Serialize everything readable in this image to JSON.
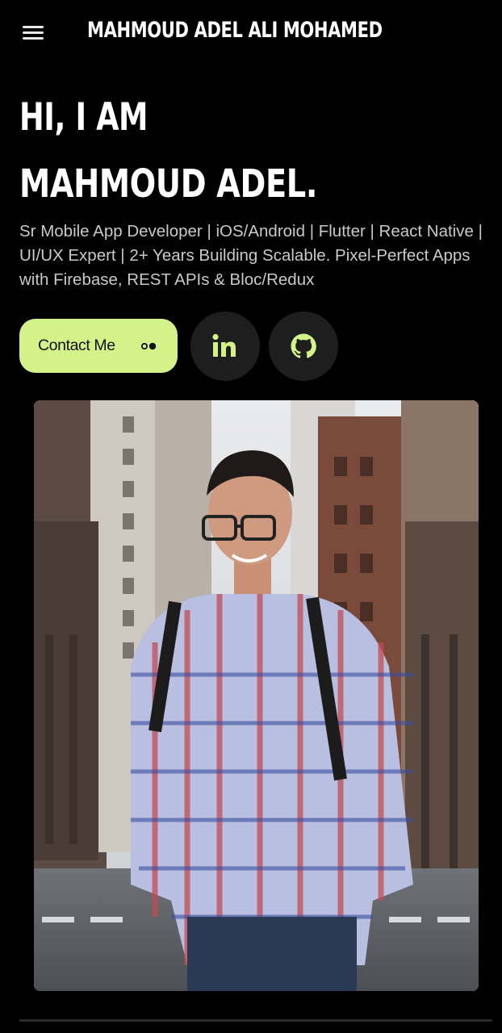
{
  "header": {
    "menu_icon": "hamburger-menu-icon",
    "brand": "MAHMOUD ADEL ALI MOHAMED"
  },
  "hero": {
    "greeting": "HI, I AM",
    "name": "MAHMOUD ADEL.",
    "tagline": "Sr Mobile App Developer | iOS/Android | Flutter | React Native | UI/UX Expert | 2+ Years Building Scalable. Pixel-Perfect Apps with Firebase, REST APIs & Bloc/Redux"
  },
  "actions": {
    "contact_label": "Contact Me",
    "contact_icon": "dots-icon",
    "linkedin_icon": "linkedin-icon",
    "github_icon": "github-icon"
  },
  "colors": {
    "background": "#000000",
    "accent": "#d4f28a",
    "social_button_bg": "#1e1e1e",
    "social_icon": "#d4f28a",
    "tagline_text": "#c9c9c9"
  },
  "photo": {
    "alt": "Portrait photo"
  }
}
